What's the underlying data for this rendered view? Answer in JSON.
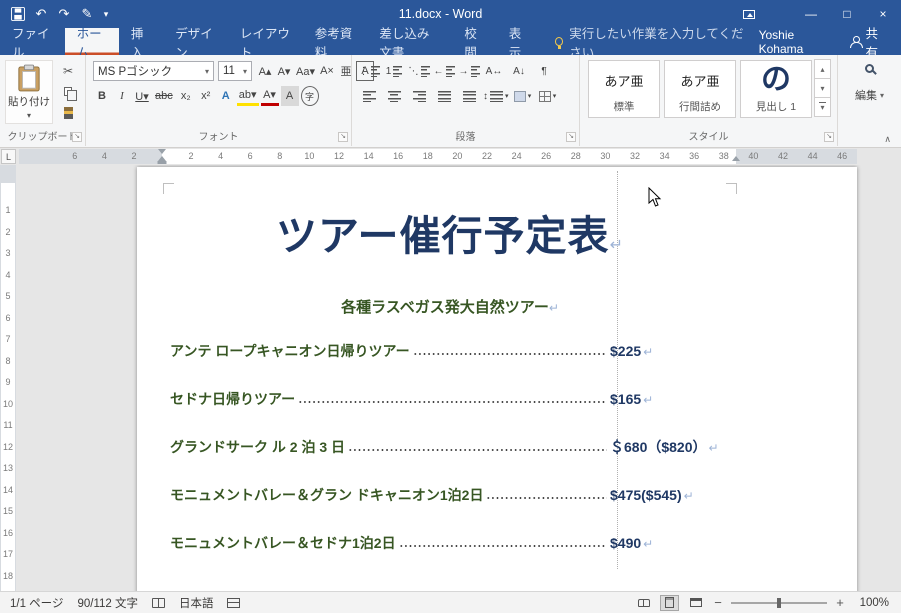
{
  "window": {
    "title": "11.docx - Word",
    "minimize_glyph": "—",
    "maximize_glyph": "□",
    "close_glyph": "×"
  },
  "qat": {
    "undo_glyph": "↶",
    "redo_glyph": "↷",
    "touch_glyph": "✎",
    "more_glyph": "▾"
  },
  "glyphs": {
    "caret": "▾",
    "scissors": "✂",
    "launcher": "↘",
    "collapse": "∧",
    "tab_selector": "L",
    "gallery_up": "▴",
    "gallery_down": "▾",
    "gallery_more": "▾"
  },
  "tabs": [
    {
      "id": "file",
      "label": "ファイル",
      "file": true
    },
    {
      "id": "home",
      "label": "ホーム",
      "active": true
    },
    {
      "id": "insert",
      "label": "挿入"
    },
    {
      "id": "design",
      "label": "デザイン"
    },
    {
      "id": "layout",
      "label": "レイアウト"
    },
    {
      "id": "references",
      "label": "参考資料"
    },
    {
      "id": "mailings",
      "label": "差し込み文書"
    },
    {
      "id": "review",
      "label": "校閲"
    },
    {
      "id": "view",
      "label": "表示"
    }
  ],
  "tellme": {
    "text": "実行したい作業を入力してください..."
  },
  "account": {
    "user": "Yoshie Kohama",
    "share": "共有"
  },
  "ribbon": {
    "clipboard": {
      "label": "クリップボード",
      "paste": "貼り付け"
    },
    "font": {
      "label": "フォント",
      "name": "MS Pゴシック",
      "size": "11",
      "tools": [
        {
          "id": "grow-font",
          "glyph": "A▴"
        },
        {
          "id": "shrink-font",
          "glyph": "A▾"
        },
        {
          "id": "change-case",
          "glyph": "Aa▾"
        },
        {
          "id": "clear-formatting",
          "glyph": "A×"
        },
        {
          "id": "phonetic-guide",
          "glyph": "亜"
        },
        {
          "id": "enclose-characters",
          "glyph": "A"
        }
      ],
      "controls": [
        {
          "id": "bold",
          "glyph": "B"
        },
        {
          "id": "italic",
          "glyph": "I"
        },
        {
          "id": "underline",
          "glyph": "U▾"
        },
        {
          "id": "strikethrough",
          "glyph": "abc"
        },
        {
          "id": "subscript",
          "glyph": "x₂"
        },
        {
          "id": "superscript",
          "glyph": "x²"
        },
        {
          "id": "text-effects",
          "glyph": "A"
        },
        {
          "id": "highlight-color",
          "glyph": "ab▾"
        },
        {
          "id": "font-color",
          "glyph": "A▾"
        },
        {
          "id": "character-shading",
          "glyph": "A"
        },
        {
          "id": "enclose-character",
          "glyph": "字"
        }
      ]
    },
    "paragraph": {
      "label": "段落",
      "row1": [
        {
          "id": "bullet-list",
          "glyph": "⋮"
        },
        {
          "id": "number-list",
          "glyph": "1"
        },
        {
          "id": "multilevel-list",
          "glyph": "⋱"
        },
        {
          "id": "decrease-indent",
          "glyph": "←"
        },
        {
          "id": "increase-indent",
          "glyph": "→"
        },
        {
          "id": "asian-layout",
          "glyph": "A↔"
        },
        {
          "id": "sort",
          "glyph": "A↓"
        },
        {
          "id": "formatting-marks",
          "glyph": "¶"
        }
      ],
      "row2": [
        {
          "id": "align-left"
        },
        {
          "id": "align-center"
        },
        {
          "id": "align-right"
        },
        {
          "id": "justify"
        },
        {
          "id": "distribute-text"
        },
        {
          "id": "line-spacing",
          "glyph": "↕"
        },
        {
          "id": "shading"
        },
        {
          "id": "borders"
        }
      ]
    },
    "styles": {
      "label": "スタイル",
      "items": [
        {
          "name": "標準",
          "preview": "あア亜"
        },
        {
          "name": "行間詰め",
          "preview": "あア亜"
        },
        {
          "name": "見出し 1",
          "preview": "の",
          "big": true
        }
      ]
    },
    "editing": {
      "label": "編集"
    }
  },
  "ruler": {
    "left": [
      "6",
      "4",
      "2"
    ],
    "right": [
      "2",
      "4",
      "6",
      "8",
      "10",
      "12",
      "14",
      "16",
      "18",
      "20",
      "22",
      "24",
      "26",
      "28",
      "30",
      "32",
      "34",
      "36",
      "38",
      "40",
      "42",
      "44",
      "46"
    ],
    "vertical": [
      "1",
      "2",
      "3",
      "4",
      "5",
      "6",
      "7",
      "8",
      "9",
      "10",
      "11",
      "12",
      "13",
      "14",
      "15",
      "16",
      "17",
      "18"
    ]
  },
  "document": {
    "title": "ツアー催行予定表",
    "subtitle": "各種ラスベガス発大自然ツアー",
    "pilcrow": "↵",
    "items": [
      {
        "name": "アンテ ロープキャニオン日帰りツアー",
        "price": "$225"
      },
      {
        "name": "セドナ日帰りツアー",
        "price": "$165"
      },
      {
        "name": "グランドサーク ル 2 泊 3 日",
        "price": "＄680（$820）"
      },
      {
        "name": "モニュメントバレー＆グラン ドキャニオン1泊2日",
        "price": "$475($545)"
      },
      {
        "name": "モニュメントバレー＆セドナ1泊2日",
        "price": "$490"
      }
    ]
  },
  "status": {
    "page": "1/1 ページ",
    "chars": "90/112 文字",
    "language": "日本語",
    "zoom": "100%",
    "zoom_out": "−",
    "zoom_in": "+"
  },
  "colors": {
    "titlebar": "#2b579a",
    "doc_title": "#1f3864",
    "doc_green": "#375623",
    "price_navy": "#1f3864"
  }
}
